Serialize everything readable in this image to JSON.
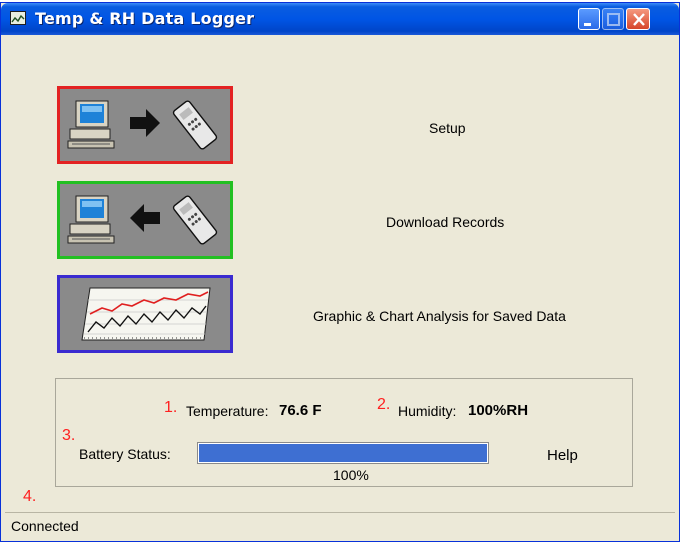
{
  "window": {
    "title": "Temp & RH Data Logger",
    "buttons": {
      "minimize": "minimize",
      "maximize": "maximize",
      "close": "close"
    }
  },
  "actions": [
    {
      "label": "Setup",
      "icons": [
        "computer-icon",
        "arrow-right-icon",
        "remote-icon"
      ],
      "border": "#e32222"
    },
    {
      "label": "Download Records",
      "icons": [
        "computer-icon",
        "arrow-left-icon",
        "remote-icon"
      ],
      "border": "#22c022"
    },
    {
      "label": "Graphic & Chart Analysis for Saved Data",
      "icons": [
        "chart-icon"
      ],
      "border": "#3a2bd0"
    }
  ],
  "status": {
    "temperature_label": "Temperature:",
    "temperature_value": "76.6 F",
    "humidity_label": "Humidity:",
    "humidity_value": "100%RH",
    "battery_label": "Battery Status:",
    "battery_percent_text": "100%",
    "battery_level": 1.0,
    "help_label": "Help"
  },
  "annotations": [
    "1.",
    "2.",
    "3.",
    "4."
  ],
  "statusbar": {
    "text": "Connected"
  }
}
